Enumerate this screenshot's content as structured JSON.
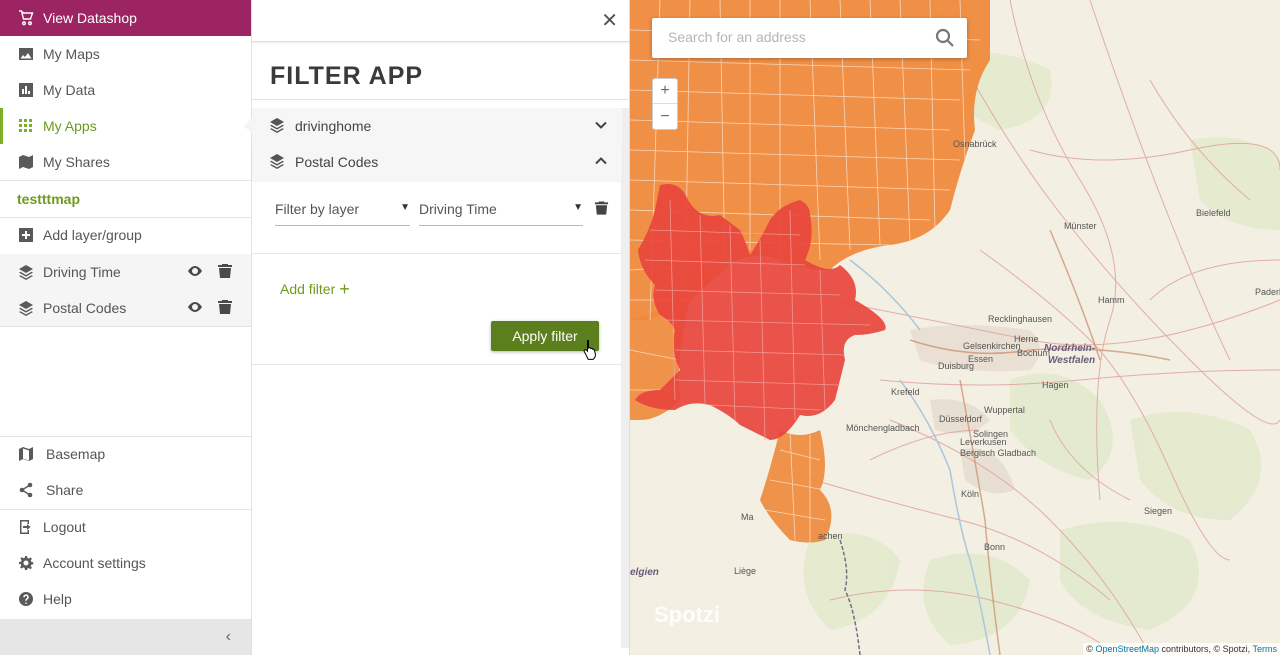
{
  "sidebar": {
    "datashop_label": "View Datashop",
    "nav": [
      {
        "label": "My Maps",
        "icon": "image-icon"
      },
      {
        "label": "My Data",
        "icon": "bar-chart-icon"
      },
      {
        "label": "My Apps",
        "icon": "grid-icon"
      },
      {
        "label": "My Shares",
        "icon": "share-map-icon"
      }
    ],
    "map_name": "testttmap",
    "add_layer_label": "Add layer/group",
    "layers": [
      {
        "label": "Driving Time"
      },
      {
        "label": "Postal Codes"
      }
    ],
    "bottom": [
      {
        "label": "Basemap",
        "icon": "map-icon"
      },
      {
        "label": "Share",
        "icon": "share-icon"
      },
      {
        "label": "Logout",
        "icon": "logout-icon"
      },
      {
        "label": "Account settings",
        "icon": "gear-icon"
      },
      {
        "label": "Help",
        "icon": "help-icon"
      }
    ],
    "collapse_glyph": "‹"
  },
  "panel": {
    "close_glyph": "✕",
    "title": "FILTER APP",
    "sections": [
      {
        "label": "drivinghome",
        "state": "collapsed"
      },
      {
        "label": "Postal Codes",
        "state": "expanded"
      }
    ],
    "filter": {
      "layer_select": "Filter by layer",
      "attribute_select": "Driving Time"
    },
    "add_filter_label": "Add filter",
    "add_filter_glyph": "+",
    "apply_label": "Apply filter"
  },
  "map": {
    "search_placeholder": "Search for an address",
    "zoom_in": "+",
    "zoom_out": "−",
    "watermark": "Spotzi",
    "attribution_prefix": "© ",
    "attribution_link": "OpenStreetMap",
    "attribution_mid": " contributors, © Spotzi, ",
    "attribution_terms": "Terms",
    "cities": [
      {
        "name": "Osnabrück"
      },
      {
        "name": "Bielefeld"
      },
      {
        "name": "Münster"
      },
      {
        "name": "Hamm"
      },
      {
        "name": "Paderbo"
      },
      {
        "name": "Recklinghausen"
      },
      {
        "name": "Herne"
      },
      {
        "name": "Gelsenkirchen"
      },
      {
        "name": "Bochum"
      },
      {
        "name": "Essen"
      },
      {
        "name": "Nordrhein-"
      },
      {
        "name": "Westfalen"
      },
      {
        "name": "Hagen"
      },
      {
        "name": "Duisburg"
      },
      {
        "name": "Krefeld"
      },
      {
        "name": "Wuppertal"
      },
      {
        "name": "Düsseldorf"
      },
      {
        "name": "Mönchengladbach"
      },
      {
        "name": "Solingen"
      },
      {
        "name": "Leverkusen"
      },
      {
        "name": "Bergisch Gladbach"
      },
      {
        "name": "Köln"
      },
      {
        "name": "Siegen"
      },
      {
        "name": "Bonn"
      },
      {
        "name": "achen"
      },
      {
        "name": "Liège"
      },
      {
        "name": "elgien"
      },
      {
        "name": "Ma"
      }
    ],
    "colors": {
      "region_orange": "#f0883a",
      "region_red": "#e8453c",
      "roads": "#e4a0a0"
    }
  }
}
